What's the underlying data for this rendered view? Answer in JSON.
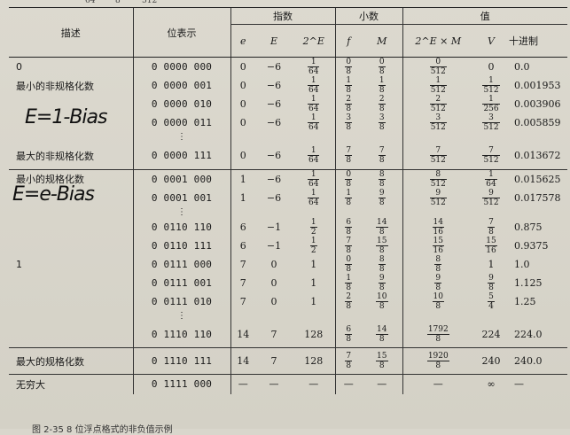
{
  "top_numbers": [
    "64",
    "8",
    "512"
  ],
  "headers": {
    "description": "描述",
    "bits": "位表示",
    "exponent_group": "指数",
    "fraction_group": "小数",
    "value_group": "值",
    "e": "e",
    "E": "E",
    "twoE": "2^E",
    "f": "f",
    "M": "M",
    "twoExM": "2^E × M",
    "V": "V",
    "decimal": "十进制"
  },
  "handwritten": {
    "denormal": "E=1-Bias",
    "normal": "E=e-Bias"
  },
  "dots": "⋮",
  "rows": [
    {
      "desc": "0",
      "bits": "0 0000 000",
      "e": "0",
      "E": "−6",
      "twoE": [
        "1",
        "64"
      ],
      "f": [
        "0",
        "8"
      ],
      "M": [
        "0",
        "8"
      ],
      "p": [
        "0",
        "512"
      ],
      "V": "0",
      "Vfrac": null,
      "dec": "0.0"
    },
    {
      "desc": "最小的非规格化数",
      "bits": "0 0000 001",
      "e": "0",
      "E": "−6",
      "twoE": [
        "1",
        "64"
      ],
      "f": [
        "1",
        "8"
      ],
      "M": [
        "1",
        "8"
      ],
      "p": [
        "1",
        "512"
      ],
      "V": null,
      "Vfrac": [
        "1",
        "512"
      ],
      "dec": "0.001953"
    },
    {
      "desc": "",
      "bits": "0 0000 010",
      "e": "0",
      "E": "−6",
      "twoE": [
        "1",
        "64"
      ],
      "f": [
        "2",
        "8"
      ],
      "M": [
        "2",
        "8"
      ],
      "p": [
        "2",
        "512"
      ],
      "V": null,
      "Vfrac": [
        "1",
        "256"
      ],
      "dec": "0.003906"
    },
    {
      "desc": "",
      "bits": "0 0000 011",
      "e": "0",
      "E": "−6",
      "twoE": [
        "1",
        "64"
      ],
      "f": [
        "3",
        "8"
      ],
      "M": [
        "3",
        "8"
      ],
      "p": [
        "3",
        "512"
      ],
      "V": null,
      "Vfrac": [
        "3",
        "512"
      ],
      "dec": "0.005859"
    },
    {
      "desc": "最大的非规格化数",
      "bits": "0 0000 111",
      "e": "0",
      "E": "−6",
      "twoE": [
        "1",
        "64"
      ],
      "f": [
        "7",
        "8"
      ],
      "M": [
        "7",
        "8"
      ],
      "p": [
        "7",
        "512"
      ],
      "V": null,
      "Vfrac": [
        "7",
        "512"
      ],
      "dec": "0.013672"
    },
    {
      "desc": "最小的规格化数",
      "bits": "0 0001 000",
      "e": "1",
      "E": "−6",
      "twoE": [
        "1",
        "64"
      ],
      "f": [
        "0",
        "8"
      ],
      "M": [
        "8",
        "8"
      ],
      "p": [
        "8",
        "512"
      ],
      "V": null,
      "Vfrac": [
        "1",
        "64"
      ],
      "dec": "0.015625"
    },
    {
      "desc": "",
      "bits": "0 0001 001",
      "e": "1",
      "E": "−6",
      "twoE": [
        "1",
        "64"
      ],
      "f": [
        "1",
        "8"
      ],
      "M": [
        "9",
        "8"
      ],
      "p": [
        "9",
        "512"
      ],
      "V": null,
      "Vfrac": [
        "9",
        "512"
      ],
      "dec": "0.017578"
    },
    {
      "desc": "",
      "bits": "0 0110 110",
      "e": "6",
      "E": "−1",
      "twoE": [
        "1",
        "2"
      ],
      "f": [
        "6",
        "8"
      ],
      "M": [
        "14",
        "8"
      ],
      "p": [
        "14",
        "16"
      ],
      "V": null,
      "Vfrac": [
        "7",
        "8"
      ],
      "dec": "0.875"
    },
    {
      "desc": "",
      "bits": "0 0110 111",
      "e": "6",
      "E": "−1",
      "twoE": [
        "1",
        "2"
      ],
      "f": [
        "7",
        "8"
      ],
      "M": [
        "15",
        "8"
      ],
      "p": [
        "15",
        "16"
      ],
      "V": null,
      "Vfrac": [
        "15",
        "16"
      ],
      "dec": "0.9375"
    },
    {
      "desc": "1",
      "bits": "0 0111 000",
      "e": "7",
      "E": "0",
      "twoE": "1",
      "f": [
        "0",
        "8"
      ],
      "M": [
        "8",
        "8"
      ],
      "p": [
        "8",
        "8"
      ],
      "V": "1",
      "Vfrac": null,
      "dec": "1.0"
    },
    {
      "desc": "",
      "bits": "0 0111 001",
      "e": "7",
      "E": "0",
      "twoE": "1",
      "f": [
        "1",
        "8"
      ],
      "M": [
        "9",
        "8"
      ],
      "p": [
        "9",
        "8"
      ],
      "V": null,
      "Vfrac": [
        "9",
        "8"
      ],
      "dec": "1.125"
    },
    {
      "desc": "",
      "bits": "0 0111 010",
      "e": "7",
      "E": "0",
      "twoE": "1",
      "f": [
        "2",
        "8"
      ],
      "M": [
        "10",
        "8"
      ],
      "p": [
        "10",
        "8"
      ],
      "V": null,
      "Vfrac": [
        "5",
        "4"
      ],
      "dec": "1.25"
    },
    {
      "desc": "",
      "bits": "0 1110 110",
      "e": "14",
      "E": "7",
      "twoE": "128",
      "f": [
        "6",
        "8"
      ],
      "M": [
        "14",
        "8"
      ],
      "p": [
        "1792",
        "8"
      ],
      "V": "224",
      "Vfrac": null,
      "dec": "224.0"
    },
    {
      "desc": "最大的规格化数",
      "bits": "0 1110 111",
      "e": "14",
      "E": "7",
      "twoE": "128",
      "f": [
        "7",
        "8"
      ],
      "M": [
        "15",
        "8"
      ],
      "p": [
        "1920",
        "8"
      ],
      "V": "240",
      "Vfrac": null,
      "dec": "240.0"
    },
    {
      "desc": "无穷大",
      "bits": "0 1111 000",
      "e": "—",
      "E": "—",
      "twoE": "—",
      "f": "—",
      "M": "—",
      "p": "—",
      "V": "∞",
      "Vfrac": null,
      "dec": "—"
    }
  ],
  "caption": "图 2-35 8 位浮点格式的非负值示例"
}
